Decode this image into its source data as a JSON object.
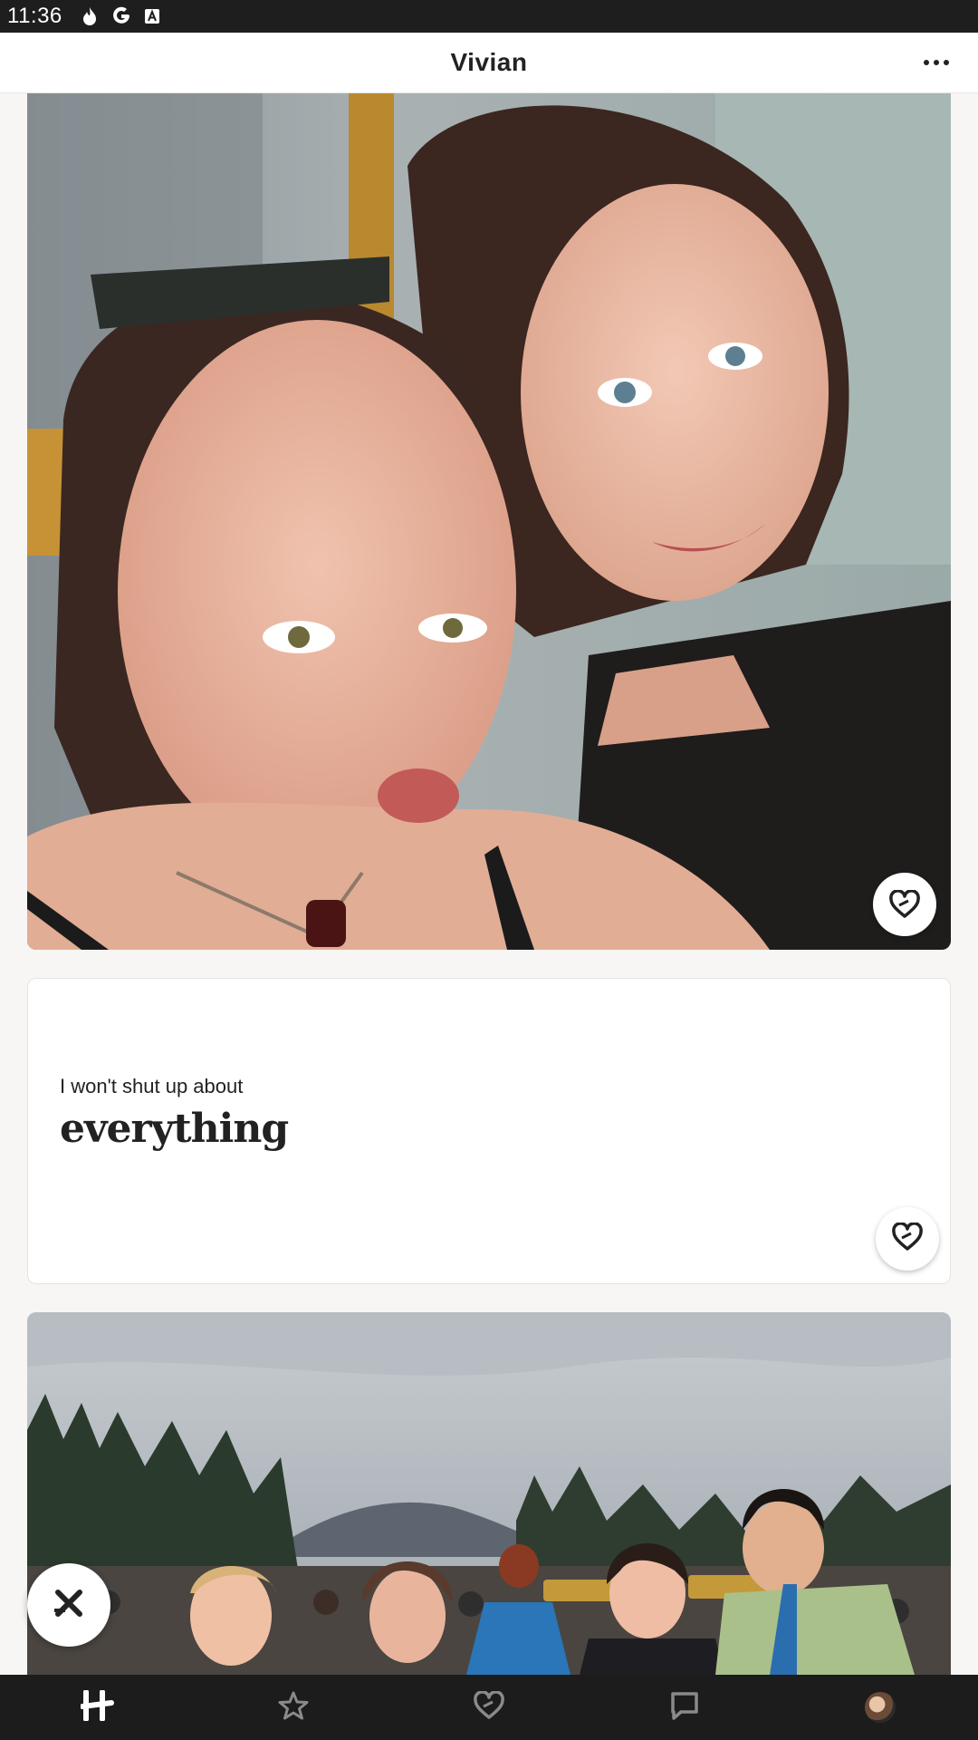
{
  "status_bar": {
    "time": "11:36",
    "icons": [
      "fire-icon",
      "google-icon",
      "font-icon"
    ]
  },
  "header": {
    "title": "Vivian",
    "more_icon": "more-dots-icon"
  },
  "profile": {
    "photo_1": {
      "alt": "photo",
      "like_icon": "heart-icon"
    },
    "prompt": {
      "question": "I won't shut up about",
      "answer": "everything",
      "like_icon": "heart-icon"
    },
    "photo_2": {
      "alt": "photo"
    }
  },
  "skip_button": {
    "icon": "close-icon"
  },
  "bottom_nav": {
    "items": [
      {
        "icon": "hinge-logo-icon",
        "active": true
      },
      {
        "icon": "star-icon",
        "active": false
      },
      {
        "icon": "heart-icon",
        "active": false
      },
      {
        "icon": "chat-icon",
        "active": false
      },
      {
        "icon": "profile-avatar",
        "active": false
      }
    ]
  },
  "colors": {
    "accent_dark": "#1c1c1c",
    "background": "#f7f6f4",
    "card": "#ffffff"
  }
}
